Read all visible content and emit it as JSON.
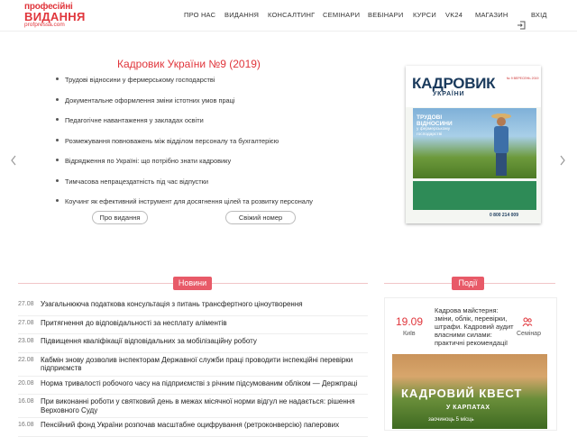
{
  "logo": {
    "line1": "професійні",
    "line2": "ВИДАННЯ",
    "line3": "profpressa.com"
  },
  "nav": {
    "items": [
      "ПРО НАС",
      "ВИДАННЯ",
      "КОНСАЛТИНГ",
      "СЕМІНАРИ",
      "ВЕБІНАРИ",
      "КУРСИ",
      "VK24",
      "МАГАЗИН"
    ],
    "login": "ВХІД"
  },
  "slider": {
    "title": "Кадровик України №9 (2019)",
    "bullets": [
      "Трудові відносини у фермерському господарстві",
      "Документальне оформлення зміни істотних умов праці",
      "Педагогічне навантаження у закладах освіти",
      "Розмежування повноважень між відділом персоналу та бухгалтерією",
      "Відрядження по Україні: що потрібно знати кадровику",
      "Тимчасова непрацездатність під час відпустки",
      "Коучинг як ефективний інструмент для досягнення цілей та розвитку персоналу"
    ],
    "btn_about": "Про видання",
    "btn_fresh": "Свіжий номер",
    "cover": {
      "title": "КАДРОВИК",
      "subtitle": "УКРАЇНИ",
      "issue": "№ 9 ВЕРЕСЕНЬ 2019",
      "headline": "ТРУДОВІ ВІДНОСИНИ",
      "headline_sub": "у фермерському господарстві",
      "phone": "0 800 214 009"
    }
  },
  "news": {
    "header": "Новини",
    "items": [
      {
        "date": "27.08",
        "text": "Узагальнююча податкова консультація з питань трансфертного ціноутворення"
      },
      {
        "date": "27.08",
        "text": "Притягнення до відповідальності за несплату аліментів"
      },
      {
        "date": "23.08",
        "text": "Підвищення кваліфікації відповідальних за мобілізаційну роботу"
      },
      {
        "date": "22.08",
        "text": "Кабмін знову дозволив інспекторам Державної служби праці проводити інспекційні перевірки підприємств"
      },
      {
        "date": "20.08",
        "text": "Норма тривалості робочого часу на підприємстві з річним підсумованим обліком — Держпраці"
      },
      {
        "date": "16.08",
        "text": "При виконанні роботи у святковий день в межах місячної норми відгул не надається: рішення Верховного Суду"
      },
      {
        "date": "16.08",
        "text": "Пенсійний фонд України розпочав масштабне оцифрування (ретроконверсію) паперових"
      }
    ]
  },
  "events": {
    "header": "Події",
    "item": {
      "date": "19.09",
      "city": "Київ",
      "title": "Кадрова майстерня: зміни, облік, перевірки, штрафи. Кадровий аудит власними силами: практичні рекомендації",
      "type": "Семінар"
    },
    "banner": {
      "title": "КАДРОВИЙ КВЕСТ",
      "subtitle": "У КАРПАТАХ",
      "note": "заочиноць 5 місць"
    }
  },
  "colors": {
    "accent": "#e0353b",
    "badge": "#e85a68",
    "line": "#f1c5c8"
  }
}
